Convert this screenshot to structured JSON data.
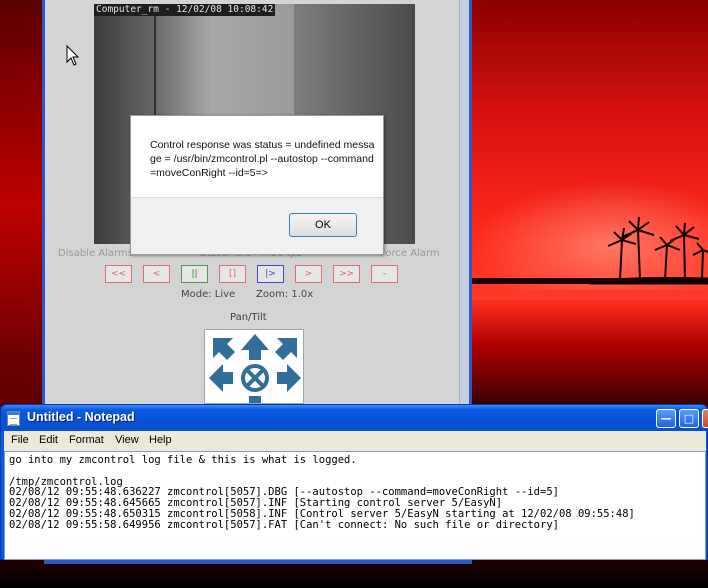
{
  "camera": {
    "caption": "Computer_rm - 12/02/08 10:08:42"
  },
  "zm": {
    "disable_alarms": "Disable Alarms",
    "state": "State: Idle - 7.30 fps",
    "force_alarm": "Force Alarm",
    "controls": [
      "<<",
      "<",
      "||",
      "[]",
      "|>",
      ">",
      ">>",
      "-"
    ],
    "mode": "Mode: Live",
    "zoom": "Zoom: 1.0x",
    "pantilt": "Pan/Tilt"
  },
  "alert": {
    "message": "Control response was status = undefined message = /usr/bin/zmcontrol.pl --autostop --command=moveConRight --id=5=>",
    "ok_label": "OK"
  },
  "notepad": {
    "title": "Untitled - Notepad",
    "menu": [
      "File",
      "Edit",
      "Format",
      "View",
      "Help"
    ],
    "content": "go into my zmcontrol log file & this is what is logged.\n\n/tmp/zmcontrol.log\n02/08/12 09:55:48.636227 zmcontrol[5057].DBG [--autostop --command=moveConRight --id=5]\n02/08/12 09:55:48.645665 zmcontrol[5057].INF [Starting control server 5/EasyN]\n02/08/12 09:55:48.650315 zmcontrol[5058].INF [Control server 5/EasyN starting at 12/02/08 09:55:48]\n02/08/12 09:55:58.649956 zmcontrol[5057].FAT [Can't connect: No such file or directory]"
  },
  "colors": {
    "xp_blue": "#0a5ae0",
    "wallpaper_red": "#ff2a1a",
    "control_red": "#e07070",
    "pantilt_arrow": "#2f6f9a"
  }
}
